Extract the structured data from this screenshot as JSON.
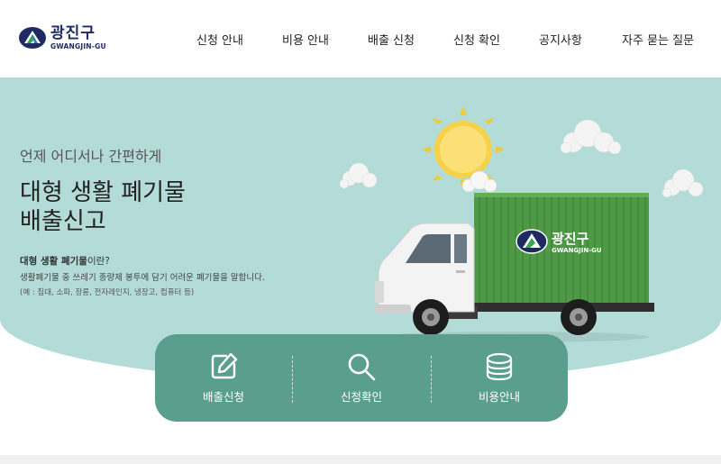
{
  "logo": {
    "ko": "광진구",
    "en": "GWANGJIN-GU"
  },
  "nav": {
    "items": [
      {
        "label": "신청 안내"
      },
      {
        "label": "비용 안내"
      },
      {
        "label": "배출 신청"
      },
      {
        "label": "신청 확인"
      },
      {
        "label": "공지사항"
      },
      {
        "label": "자주 묻는 질문"
      }
    ]
  },
  "hero": {
    "subtitle": "언제 어디서나 간편하게",
    "title_line1": "대형 생활 폐기물",
    "title_line2": "배출신고",
    "desc_title_bold": "대형 생활 폐기물",
    "desc_title_rest": "이란?",
    "desc": "생활폐기물 중 쓰레기 종량제 봉투에 담기 어려운 폐기물을 말합니다.",
    "note": "(예 : 침대, 소파, 장롱, 전자레인지, 냉장고, 컴퓨터 등)"
  },
  "truck": {
    "logo_ko": "광진구",
    "logo_en": "GWANGJIN-GU"
  },
  "quick": {
    "items": [
      {
        "label": "배출신청",
        "icon": "edit-icon"
      },
      {
        "label": "신청확인",
        "icon": "search-icon"
      },
      {
        "label": "비용안내",
        "icon": "coins-icon"
      }
    ]
  },
  "colors": {
    "hero_bg": "#b3dcd8",
    "quick_bg": "#5a9e8d",
    "truck_box": "#4f9a46",
    "brand_navy": "#1f2a63"
  }
}
